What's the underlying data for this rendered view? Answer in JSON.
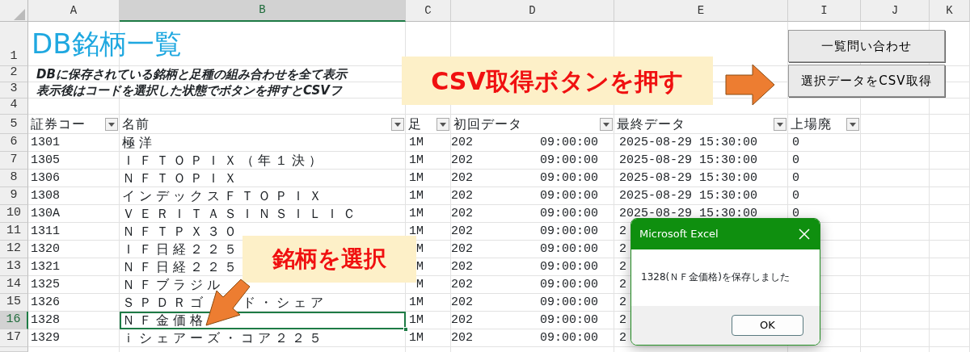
{
  "column_headers": [
    {
      "label": "A",
      "selected": false
    },
    {
      "label": "B",
      "selected": true
    },
    {
      "label": "C",
      "selected": false
    },
    {
      "label": "D",
      "selected": false
    },
    {
      "label": "E",
      "selected": false
    },
    {
      "label": "I",
      "selected": false
    },
    {
      "label": "J",
      "selected": false
    },
    {
      "label": "K",
      "selected": false
    }
  ],
  "top_row_numbers": [
    "1",
    "2",
    "3",
    "4",
    "5"
  ],
  "title": "DB銘柄一覧",
  "description_lines": [
    "DBに保存されている銘柄と足種の組み合わせを全て表示",
    "表示後はコードを選択した状態でボタンを押すとCSVフ"
  ],
  "table": {
    "columns": [
      "証券コー",
      "名前",
      "足",
      "初回データ",
      "最終データ",
      "上場廃"
    ],
    "rows": [
      {
        "row_number": "6",
        "code": "1301",
        "name": "極洋",
        "interval": "1M",
        "first_date": "202",
        "first_time": "09:00:00",
        "last": "2025-08-29 15:30:00",
        "delisted": "0",
        "selected": false
      },
      {
        "row_number": "7",
        "code": "1305",
        "name": "ＩＦＴＯＰＩＸ（年１決）",
        "interval": "1M",
        "first_date": "202",
        "first_time": "09:00:00",
        "last": "2025-08-29 15:30:00",
        "delisted": "0",
        "selected": false
      },
      {
        "row_number": "8",
        "code": "1306",
        "name": "ＮＦＴＯＰＩＸ",
        "interval": "1M",
        "first_date": "202",
        "first_time": "09:00:00",
        "last": "2025-08-29 15:30:00",
        "delisted": "0",
        "selected": false
      },
      {
        "row_number": "9",
        "code": "1308",
        "name": "インデックスＦＴＯＰＩＸ",
        "interval": "1M",
        "first_date": "202",
        "first_time": "09:00:00",
        "last": "2025-08-29 15:30:00",
        "delisted": "0",
        "selected": false
      },
      {
        "row_number": "10",
        "code": "130A",
        "name": "ＶＥＲＩＴＡＳＩＮＳＩＬＩＣ",
        "interval": "1M",
        "first_date": "202",
        "first_time": "09:00:00",
        "last": "2025-08-29 15:30:00",
        "delisted": "0",
        "selected": false
      },
      {
        "row_number": "11",
        "code": "1311",
        "name": "ＮＦＴＰＸ３０",
        "interval": "1M",
        "first_date": "202",
        "first_time": "09:00:00",
        "last": "2",
        "selected": false
      },
      {
        "row_number": "12",
        "code": "1320",
        "name": "ＩＦ日経２２５",
        "interval": "M",
        "first_date": "202",
        "first_time": "09:00:00",
        "last": "2",
        "selected": false
      },
      {
        "row_number": "13",
        "code": "1321",
        "name": "ＮＦ日経２２５",
        "interval": "M",
        "first_date": "202",
        "first_time": "09:00:00",
        "last": "2",
        "selected": false
      },
      {
        "row_number": "14",
        "code": "1325",
        "name": "ＮＦブラジル",
        "interval": "M",
        "first_date": "202",
        "first_time": "09:00:00",
        "last": "2",
        "selected": false
      },
      {
        "row_number": "15",
        "code": "1326",
        "name": "ＳＰＤＲゴ",
        "name_after_arrow": "ド・シェア",
        "interval": "1M",
        "first_date": "202",
        "first_time": "09:00:00",
        "last": "2",
        "selected": false
      },
      {
        "row_number": "16",
        "code": "1328",
        "name": "ＮＦ金価格",
        "interval": "1M",
        "first_date": "202",
        "first_time": "09:00:00",
        "last": "2",
        "selected": true
      },
      {
        "row_number": "17",
        "code": "1329",
        "name": "ｉシェアーズ・コア２２５",
        "interval": "1M",
        "first_date": "202",
        "first_time": "09:00:00",
        "last": "2",
        "selected": false
      }
    ]
  },
  "buttons": [
    "一覧問い合わせ",
    "選択データをCSV取得"
  ],
  "callouts": [
    "CSV取得ボタンを押す",
    "銘柄を選択"
  ],
  "dialog": {
    "title": "Microsoft Excel",
    "message": "1328(ＮＦ金価格)を保存しました",
    "button": "OK"
  }
}
